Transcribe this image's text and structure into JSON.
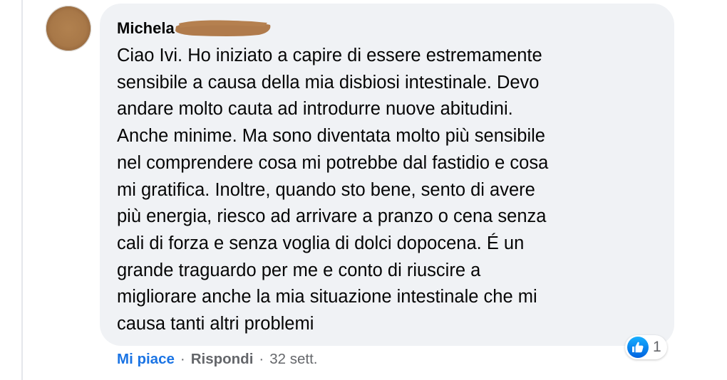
{
  "comment": {
    "author_name": "Michela",
    "text": "Ciao Ivi. Ho iniziato a capire di essere estremamente\nsensibile a causa della mia disbiosi intestinale. Devo\nandare molto cauta ad introdurre nuove abitudini.\nAnche minime. Ma sono diventata molto più sensibile\nnel comprendere cosa mi potrebbe dal fastidio e cosa\nmi gratifica. Inoltre, quando sto bene, sento di avere\npiù energia, riesco ad arrivare a pranzo o cena senza\ncali di forza e senza voglia di dolci dopocena. É un\ngrande traguardo per me e conto di riuscire a\nmigliorare anche la mia situazione intestinale che mi\ncausa tanti altri problemi"
  },
  "reactions": {
    "icon": "like-icon",
    "count": "1"
  },
  "actions": {
    "like_label": "Mi piace",
    "reply_label": "Rispondi",
    "separator": "·",
    "timestamp": "32 sett."
  },
  "colors": {
    "bubble_bg": "#f0f2f5",
    "like_blue": "#1b74e4",
    "meta_gray": "#65676b",
    "redaction_brown": "#b07b4c"
  }
}
